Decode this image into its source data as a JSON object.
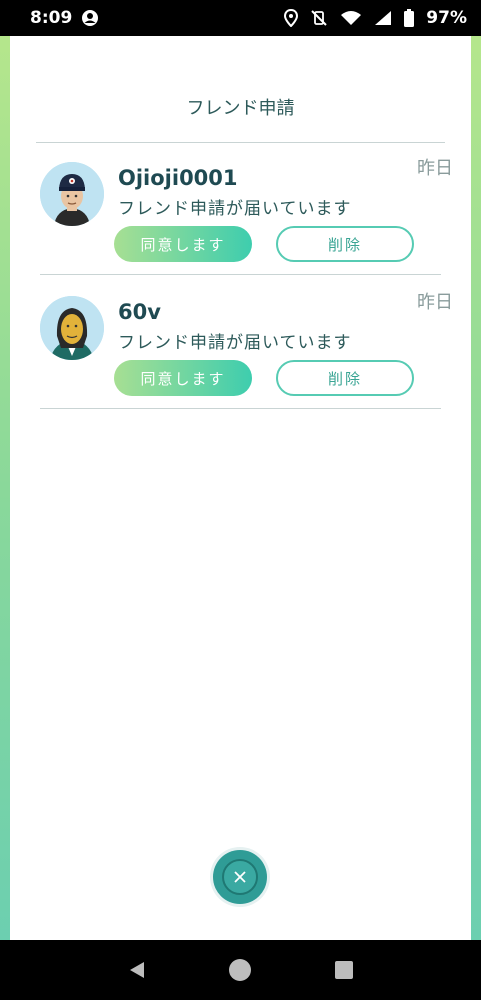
{
  "status_bar": {
    "time": "8:09",
    "battery": "97%",
    "icons": [
      "account-icon",
      "location-icon",
      "vibrate-off-icon",
      "wifi-icon",
      "signal-icon",
      "battery-icon"
    ]
  },
  "page": {
    "title": "フレンド申請"
  },
  "requests": [
    {
      "name": "Ojioji0001",
      "message": "フレンド申請が届いています",
      "time": "昨日",
      "accept_label": "同意します",
      "delete_label": "削除"
    },
    {
      "name": "60v",
      "message": "フレンド申請が届いています",
      "time": "昨日",
      "accept_label": "同意します",
      "delete_label": "削除"
    }
  ],
  "colors": {
    "accent": "#3ecdae",
    "accent_light": "#a7df93",
    "text_dark": "#1f4a52",
    "close_button": "#2f9c96"
  },
  "nav_bar": {
    "icons": [
      "back-icon",
      "home-icon",
      "recents-icon"
    ]
  }
}
